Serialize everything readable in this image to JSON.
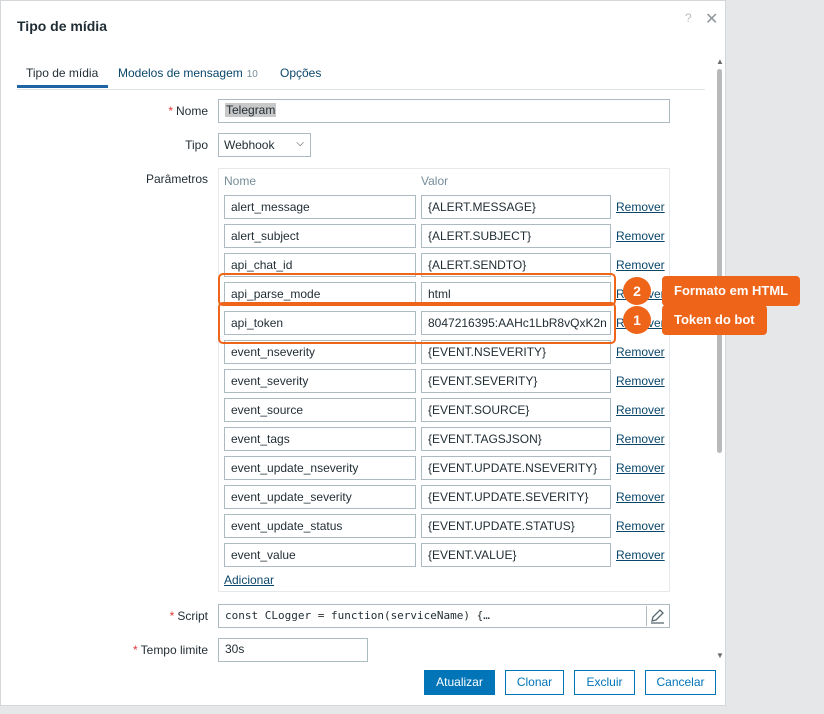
{
  "dialog": {
    "title": "Tipo de mídia",
    "help_icon": "?",
    "close_icon": "✕"
  },
  "tabs": [
    {
      "label": "Tipo de mídia",
      "active": true
    },
    {
      "label": "Modelos de mensagem",
      "count": "10"
    },
    {
      "label": "Opções"
    }
  ],
  "form": {
    "name_label": "Nome",
    "name_value": "Telegram",
    "type_label": "Tipo",
    "type_value": "Webhook",
    "params_label": "Parâmetros",
    "col_name": "Nome",
    "col_value": "Valor",
    "remove_label": "Remover",
    "add_label": "Adicionar",
    "script_label": "Script",
    "script_value": "const CLogger = function(serviceName) {…",
    "timeout_label": "Tempo limite",
    "timeout_value": "30s"
  },
  "params": [
    {
      "name": "alert_message",
      "value": "{ALERT.MESSAGE}"
    },
    {
      "name": "alert_subject",
      "value": "{ALERT.SUBJECT}"
    },
    {
      "name": "api_chat_id",
      "value": "{ALERT.SENDTO}"
    },
    {
      "name": "api_parse_mode",
      "value": "html"
    },
    {
      "name": "api_token",
      "value": "8047216395:AAHc1LbR8vQxK2n"
    },
    {
      "name": "event_nseverity",
      "value": "{EVENT.NSEVERITY}"
    },
    {
      "name": "event_severity",
      "value": "{EVENT.SEVERITY}"
    },
    {
      "name": "event_source",
      "value": "{EVENT.SOURCE}"
    },
    {
      "name": "event_tags",
      "value": "{EVENT.TAGSJSON}"
    },
    {
      "name": "event_update_nseverity",
      "value": "{EVENT.UPDATE.NSEVERITY}"
    },
    {
      "name": "event_update_severity",
      "value": "{EVENT.UPDATE.SEVERITY}"
    },
    {
      "name": "event_update_status",
      "value": "{EVENT.UPDATE.STATUS}"
    },
    {
      "name": "event_value",
      "value": "{EVENT.VALUE}"
    }
  ],
  "buttons": {
    "update": "Atualizar",
    "clone": "Clonar",
    "delete": "Excluir",
    "cancel": "Cancelar"
  },
  "annotations": [
    {
      "number": "2",
      "label": "Formato em HTML"
    },
    {
      "number": "1",
      "label": "Token do bot"
    }
  ],
  "colors": {
    "accent": "#0275b8",
    "annotation": "#ee6419",
    "required": "#e33734",
    "link": "#0a466a"
  }
}
